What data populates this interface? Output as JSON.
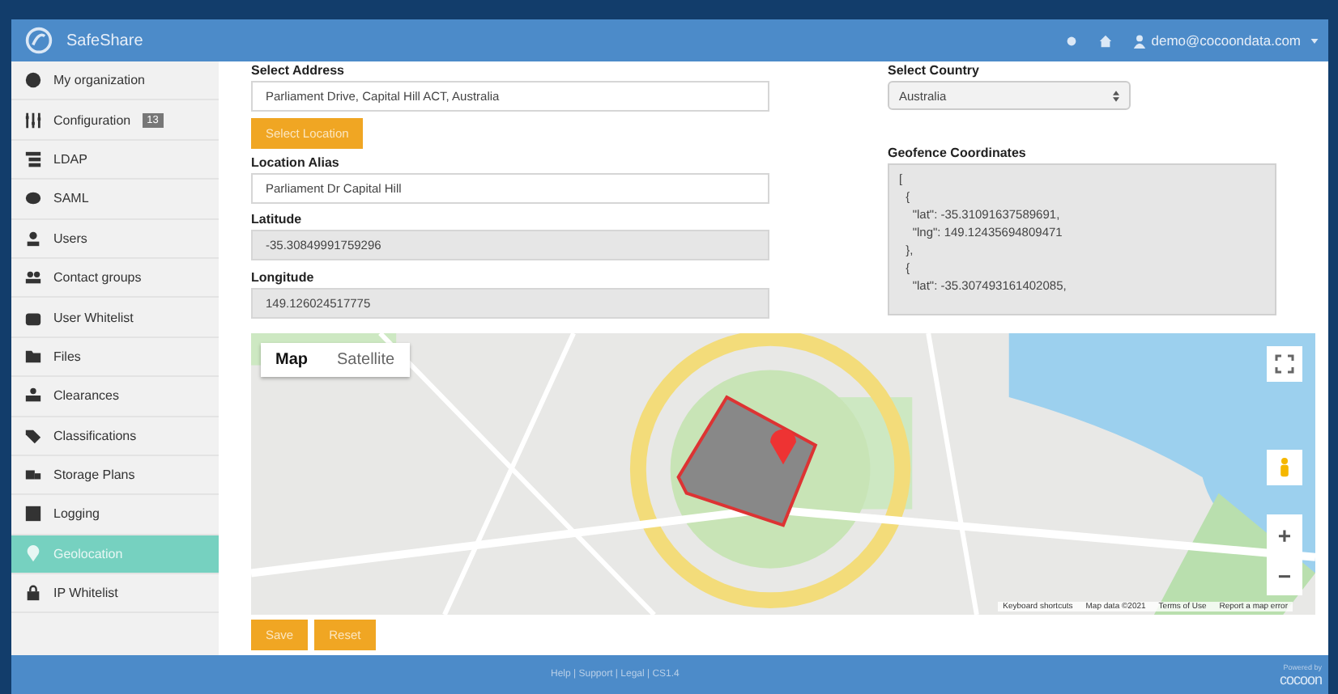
{
  "header": {
    "app_name": "SafeShare",
    "user": "demo@cocoondata.com"
  },
  "sidebar": {
    "items": [
      {
        "label": "My organization",
        "selected": false
      },
      {
        "label": "Configuration",
        "selected": false,
        "badge": "13"
      },
      {
        "label": "LDAP",
        "selected": false
      },
      {
        "label": "SAML",
        "selected": false
      },
      {
        "label": "Users",
        "selected": false
      },
      {
        "label": "Contact groups",
        "selected": false
      },
      {
        "label": "User Whitelist",
        "selected": false
      },
      {
        "label": "Files",
        "selected": false
      },
      {
        "label": "Clearances",
        "selected": false
      },
      {
        "label": "Classifications",
        "selected": false
      },
      {
        "label": "Storage Plans",
        "selected": false
      },
      {
        "label": "Logging",
        "selected": false
      },
      {
        "label": "Geolocation",
        "selected": true
      },
      {
        "label": "IP Whitelist",
        "selected": false
      }
    ]
  },
  "form": {
    "address_label": "Select Address",
    "address_value": "Parliament Drive, Capital Hill ACT, Australia",
    "select_location_button": "Select Location",
    "alias_label": "Location Alias",
    "alias_value": "Parliament Dr Capital Hill",
    "latitude_label": "Latitude",
    "latitude_value": "-35.30849991759296",
    "longitude_label": "Longitude",
    "longitude_value": "149.126024517775",
    "country_label": "Select Country",
    "country_value": "Australia",
    "geofence_label": "Geofence Coordinates",
    "geofence_lines": [
      "[",
      "  {",
      "    \"lat\": -35.31091637589691,",
      "    \"lng\": 149.12435694809471",
      "  },",
      "  {",
      "    \"lat\": -35.307493161402085,"
    ]
  },
  "map": {
    "kind": "picture",
    "map_types": [
      {
        "label": "Map",
        "selected": true
      },
      {
        "label": "Satellite",
        "selected": false
      }
    ],
    "zoom_in": "+",
    "zoom_out": "−",
    "attribution": [
      "Keyboard shortcuts",
      "Map data ©2021",
      "Terms of Use",
      "Report a map error"
    ]
  },
  "buttons": [
    "Save",
    "Reset"
  ],
  "footer": {
    "links": "Help | Support | Legal | CS1.4",
    "powered_by": "Powered by",
    "brand": "cocoon"
  }
}
